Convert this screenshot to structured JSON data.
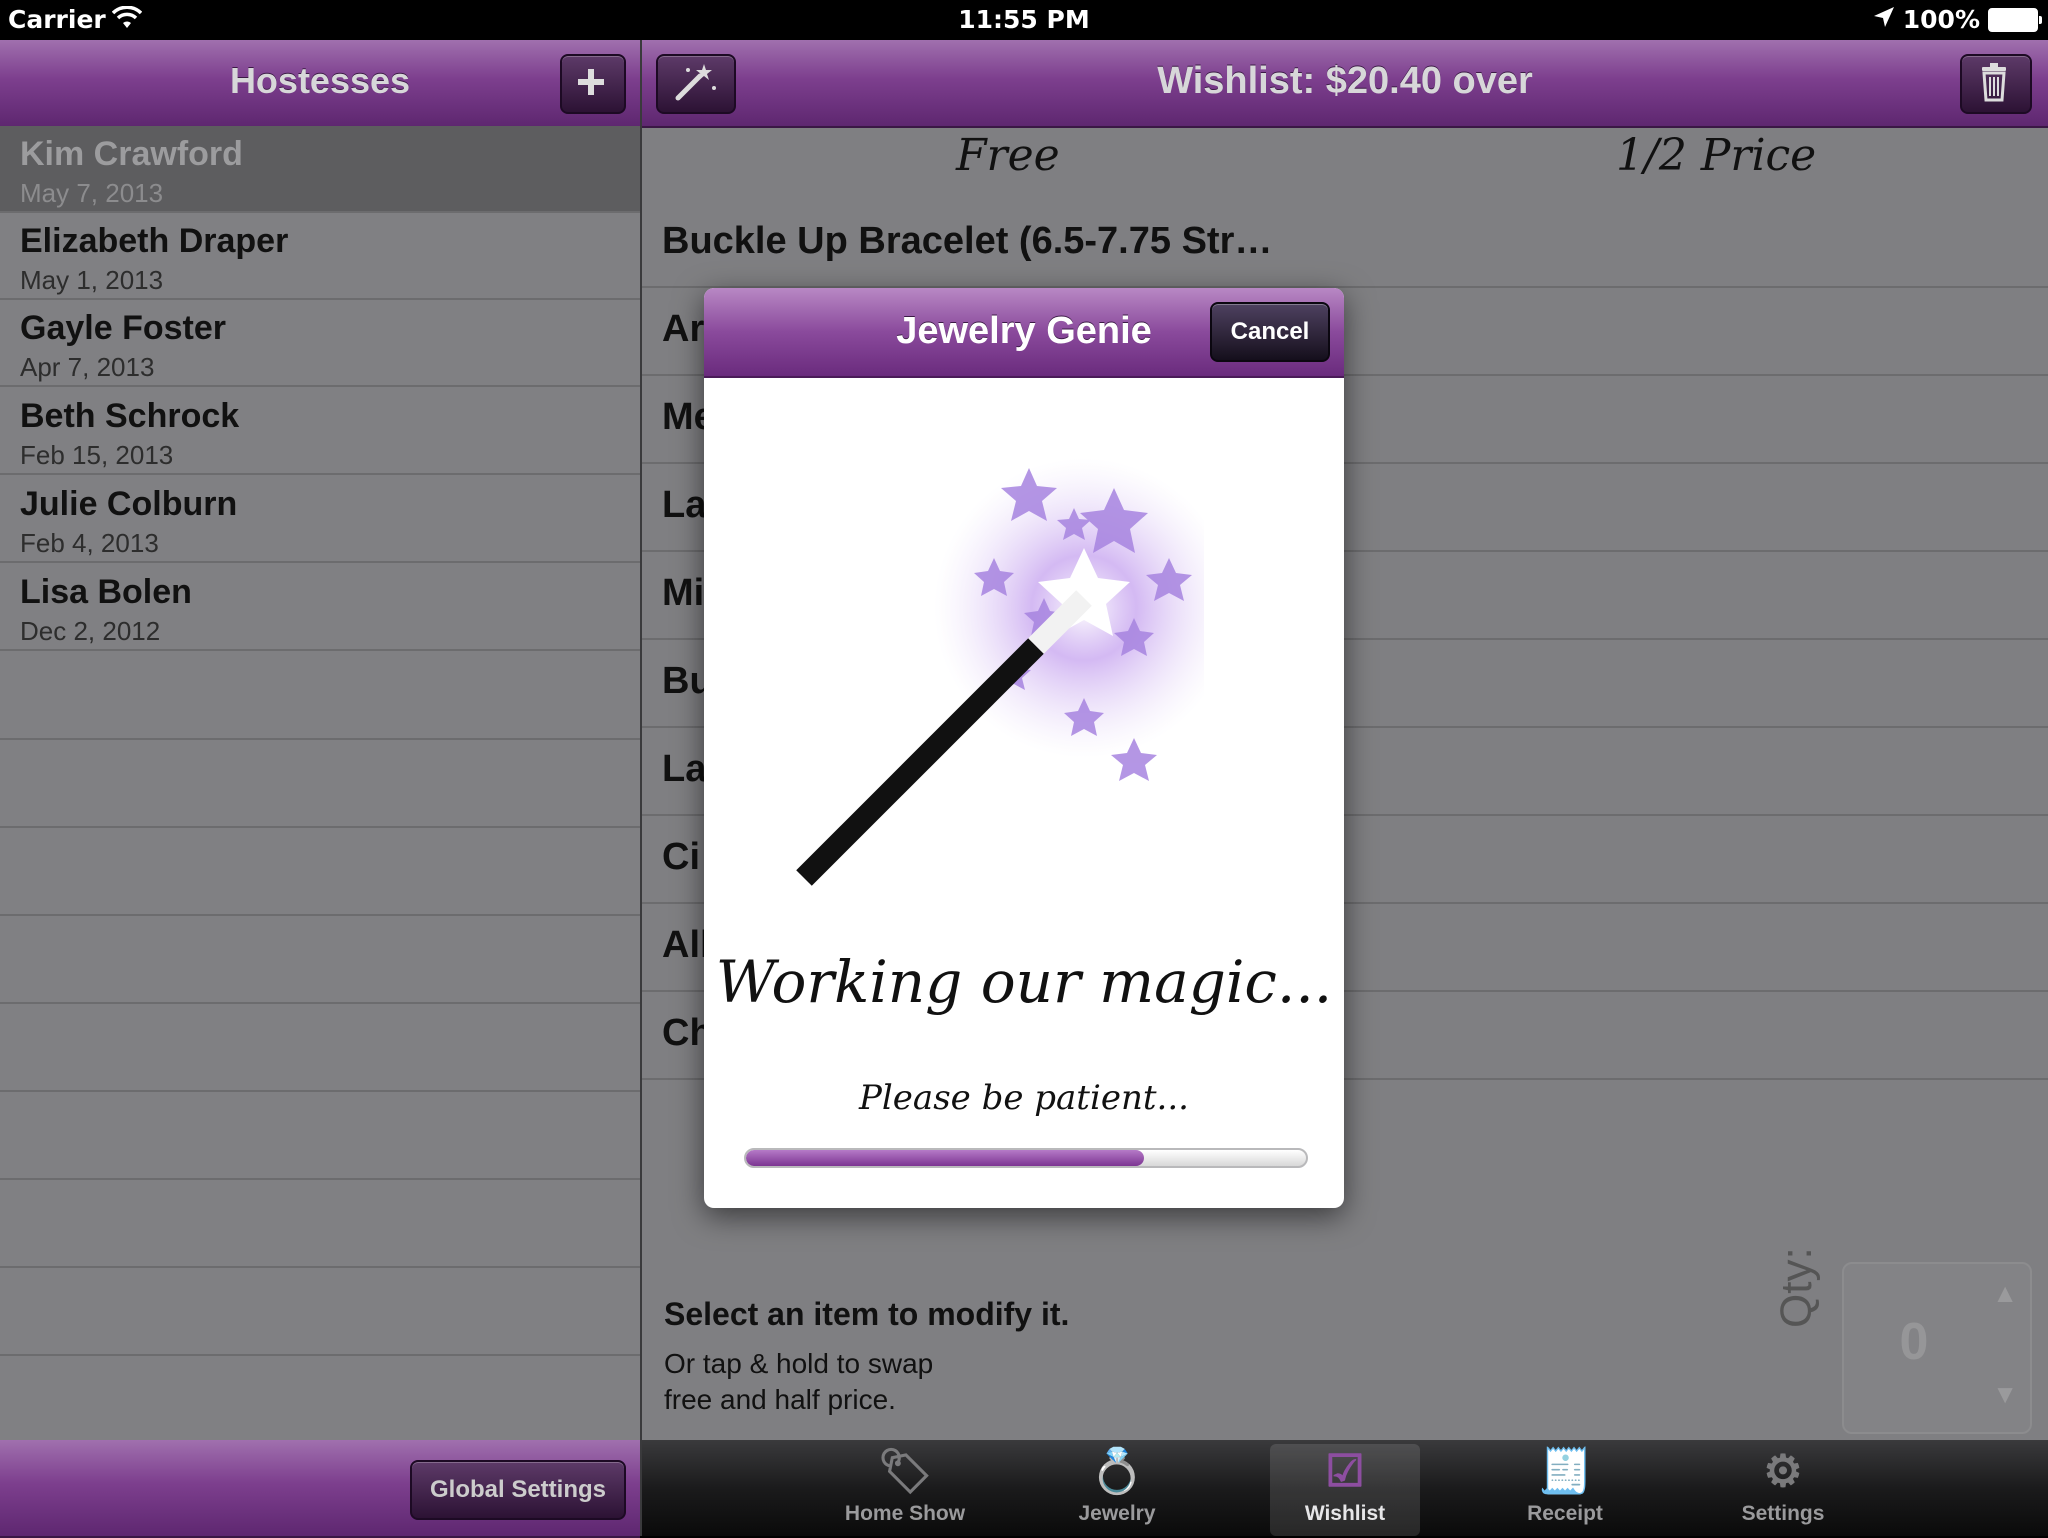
{
  "status_bar": {
    "carrier": "Carrier",
    "time": "11:55 PM",
    "battery": "100%"
  },
  "hostesses": {
    "title": "Hostesses",
    "add_icon": "plus-icon",
    "items": [
      {
        "name": "Kim Crawford",
        "date": "May 7, 2013",
        "selected": true
      },
      {
        "name": "Elizabeth Draper",
        "date": "May 1, 2013"
      },
      {
        "name": "Gayle Foster",
        "date": "Apr 7, 2013"
      },
      {
        "name": "Beth Schrock",
        "date": "Feb 15, 2013"
      },
      {
        "name": "Julie Colburn",
        "date": "Feb 4, 2013"
      },
      {
        "name": "Lisa Bolen",
        "date": "Dec 2, 2012"
      }
    ],
    "global_settings_label": "Global Settings"
  },
  "wishlist": {
    "title": "Wishlist: $20.40 over",
    "wand_icon": "magic-wand-icon",
    "trash_icon": "trash-icon",
    "col_free": "Free",
    "col_half": "1/2 Price",
    "items": [
      "Buckle Up Bracelet (6.5-7.75 Str…",
      "Ar",
      "Me",
      "La",
      "Mi",
      "Bu",
      "La",
      "Ci",
      "All",
      "Ch"
    ],
    "select_title": "Select an item to modify it.",
    "select_sub_1": "Or tap & hold to swap",
    "select_sub_2": "free and half price.",
    "qty_label": "Qty:",
    "qty_value": "0"
  },
  "tabs": [
    {
      "label": "Home Show",
      "icon": "tag-icon",
      "glyph": "🏷"
    },
    {
      "label": "Jewelry",
      "icon": "ring-icon",
      "glyph": "💍"
    },
    {
      "label": "Wishlist",
      "icon": "checkbox-icon",
      "glyph": "☑",
      "active": true
    },
    {
      "label": "Receipt",
      "icon": "receipt-icon",
      "glyph": "🧾"
    },
    {
      "label": "Settings",
      "icon": "gear-icon",
      "glyph": "⚙"
    }
  ],
  "modal": {
    "title": "Jewelry Genie",
    "cancel_label": "Cancel",
    "image_icon": "magic-wand-stars-icon",
    "message": "Working our magic...",
    "sub_message": "Please be patient...",
    "progress": 0.71
  },
  "colors": {
    "accent_purple": "#7d3f8e",
    "progress_fill": "#8a4a9c"
  }
}
